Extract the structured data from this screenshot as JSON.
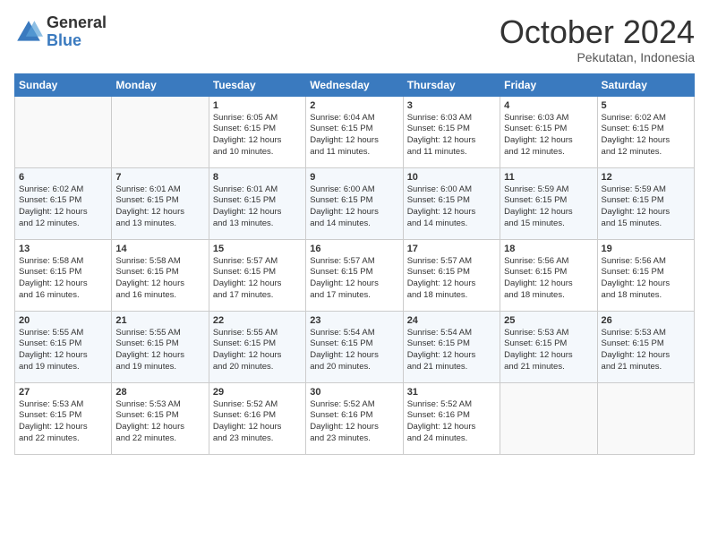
{
  "header": {
    "logo_line1": "General",
    "logo_line2": "Blue",
    "month": "October 2024",
    "location": "Pekutatan, Indonesia"
  },
  "days_of_week": [
    "Sunday",
    "Monday",
    "Tuesday",
    "Wednesday",
    "Thursday",
    "Friday",
    "Saturday"
  ],
  "weeks": [
    [
      {
        "day": "",
        "info": ""
      },
      {
        "day": "",
        "info": ""
      },
      {
        "day": "1",
        "info": "Sunrise: 6:05 AM\nSunset: 6:15 PM\nDaylight: 12 hours\nand 10 minutes."
      },
      {
        "day": "2",
        "info": "Sunrise: 6:04 AM\nSunset: 6:15 PM\nDaylight: 12 hours\nand 11 minutes."
      },
      {
        "day": "3",
        "info": "Sunrise: 6:03 AM\nSunset: 6:15 PM\nDaylight: 12 hours\nand 11 minutes."
      },
      {
        "day": "4",
        "info": "Sunrise: 6:03 AM\nSunset: 6:15 PM\nDaylight: 12 hours\nand 12 minutes."
      },
      {
        "day": "5",
        "info": "Sunrise: 6:02 AM\nSunset: 6:15 PM\nDaylight: 12 hours\nand 12 minutes."
      }
    ],
    [
      {
        "day": "6",
        "info": "Sunrise: 6:02 AM\nSunset: 6:15 PM\nDaylight: 12 hours\nand 12 minutes."
      },
      {
        "day": "7",
        "info": "Sunrise: 6:01 AM\nSunset: 6:15 PM\nDaylight: 12 hours\nand 13 minutes."
      },
      {
        "day": "8",
        "info": "Sunrise: 6:01 AM\nSunset: 6:15 PM\nDaylight: 12 hours\nand 13 minutes."
      },
      {
        "day": "9",
        "info": "Sunrise: 6:00 AM\nSunset: 6:15 PM\nDaylight: 12 hours\nand 14 minutes."
      },
      {
        "day": "10",
        "info": "Sunrise: 6:00 AM\nSunset: 6:15 PM\nDaylight: 12 hours\nand 14 minutes."
      },
      {
        "day": "11",
        "info": "Sunrise: 5:59 AM\nSunset: 6:15 PM\nDaylight: 12 hours\nand 15 minutes."
      },
      {
        "day": "12",
        "info": "Sunrise: 5:59 AM\nSunset: 6:15 PM\nDaylight: 12 hours\nand 15 minutes."
      }
    ],
    [
      {
        "day": "13",
        "info": "Sunrise: 5:58 AM\nSunset: 6:15 PM\nDaylight: 12 hours\nand 16 minutes."
      },
      {
        "day": "14",
        "info": "Sunrise: 5:58 AM\nSunset: 6:15 PM\nDaylight: 12 hours\nand 16 minutes."
      },
      {
        "day": "15",
        "info": "Sunrise: 5:57 AM\nSunset: 6:15 PM\nDaylight: 12 hours\nand 17 minutes."
      },
      {
        "day": "16",
        "info": "Sunrise: 5:57 AM\nSunset: 6:15 PM\nDaylight: 12 hours\nand 17 minutes."
      },
      {
        "day": "17",
        "info": "Sunrise: 5:57 AM\nSunset: 6:15 PM\nDaylight: 12 hours\nand 18 minutes."
      },
      {
        "day": "18",
        "info": "Sunrise: 5:56 AM\nSunset: 6:15 PM\nDaylight: 12 hours\nand 18 minutes."
      },
      {
        "day": "19",
        "info": "Sunrise: 5:56 AM\nSunset: 6:15 PM\nDaylight: 12 hours\nand 18 minutes."
      }
    ],
    [
      {
        "day": "20",
        "info": "Sunrise: 5:55 AM\nSunset: 6:15 PM\nDaylight: 12 hours\nand 19 minutes."
      },
      {
        "day": "21",
        "info": "Sunrise: 5:55 AM\nSunset: 6:15 PM\nDaylight: 12 hours\nand 19 minutes."
      },
      {
        "day": "22",
        "info": "Sunrise: 5:55 AM\nSunset: 6:15 PM\nDaylight: 12 hours\nand 20 minutes."
      },
      {
        "day": "23",
        "info": "Sunrise: 5:54 AM\nSunset: 6:15 PM\nDaylight: 12 hours\nand 20 minutes."
      },
      {
        "day": "24",
        "info": "Sunrise: 5:54 AM\nSunset: 6:15 PM\nDaylight: 12 hours\nand 21 minutes."
      },
      {
        "day": "25",
        "info": "Sunrise: 5:53 AM\nSunset: 6:15 PM\nDaylight: 12 hours\nand 21 minutes."
      },
      {
        "day": "26",
        "info": "Sunrise: 5:53 AM\nSunset: 6:15 PM\nDaylight: 12 hours\nand 21 minutes."
      }
    ],
    [
      {
        "day": "27",
        "info": "Sunrise: 5:53 AM\nSunset: 6:15 PM\nDaylight: 12 hours\nand 22 minutes."
      },
      {
        "day": "28",
        "info": "Sunrise: 5:53 AM\nSunset: 6:15 PM\nDaylight: 12 hours\nand 22 minutes."
      },
      {
        "day": "29",
        "info": "Sunrise: 5:52 AM\nSunset: 6:16 PM\nDaylight: 12 hours\nand 23 minutes."
      },
      {
        "day": "30",
        "info": "Sunrise: 5:52 AM\nSunset: 6:16 PM\nDaylight: 12 hours\nand 23 minutes."
      },
      {
        "day": "31",
        "info": "Sunrise: 5:52 AM\nSunset: 6:16 PM\nDaylight: 12 hours\nand 24 minutes."
      },
      {
        "day": "",
        "info": ""
      },
      {
        "day": "",
        "info": ""
      }
    ]
  ]
}
